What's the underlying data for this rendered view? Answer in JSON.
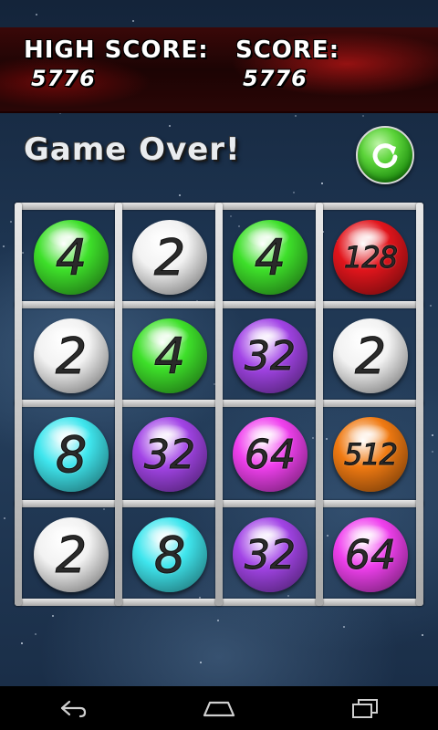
{
  "header": {
    "high_score_label": "HIGH SCORE:",
    "high_score_value": "5776",
    "score_label": "SCORE:",
    "score_value": "5776"
  },
  "status": {
    "message": "Game Over!"
  },
  "restart_icon": "restart-arrow-icon",
  "board": {
    "rows": [
      [
        "4",
        "2",
        "4",
        "128"
      ],
      [
        "2",
        "4",
        "32",
        "2"
      ],
      [
        "8",
        "32",
        "64",
        "512"
      ],
      [
        "2",
        "8",
        "32",
        "64"
      ]
    ]
  },
  "tile_colors": {
    "2": "#f2f2f2",
    "4": "#3ee02a",
    "8": "#3fe6ee",
    "32": "#a244e6",
    "64": "#f040ee",
    "128": "#e2151c",
    "512": "#f07a12"
  },
  "navbar": {
    "back_icon": "back-arrow-icon",
    "home_icon": "home-icon",
    "recents_icon": "recent-apps-icon"
  }
}
